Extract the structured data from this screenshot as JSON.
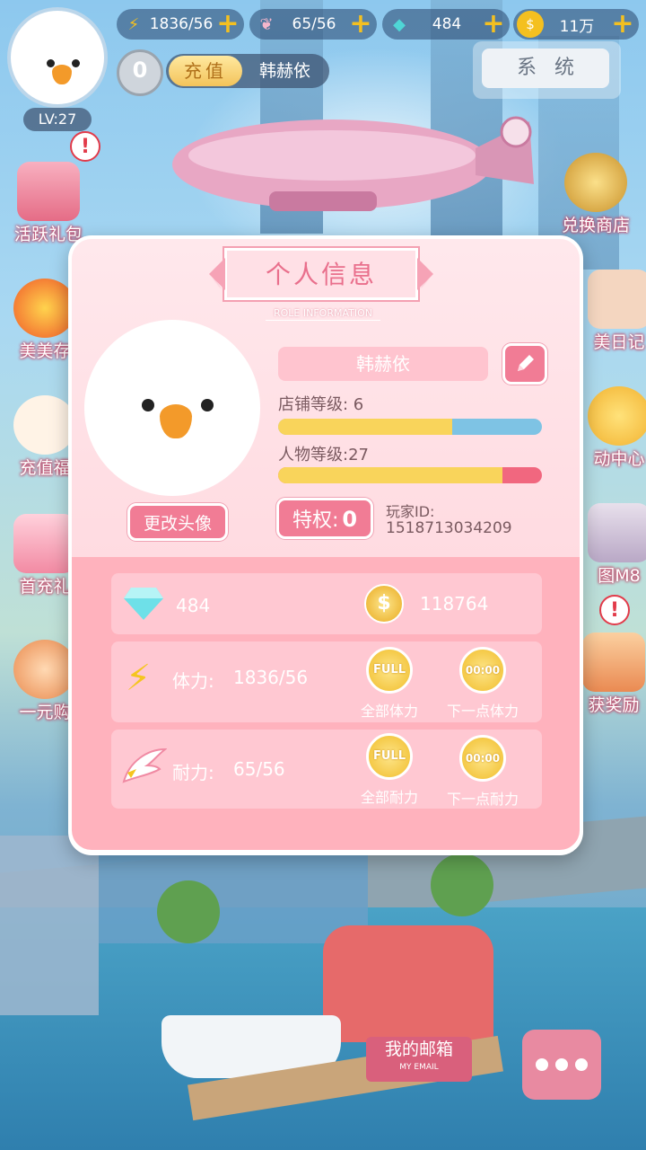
{
  "top_bar": {
    "energy": "1836/56",
    "stamina": "65/56",
    "diamonds": "484",
    "coins": "11万",
    "plus": "+"
  },
  "player": {
    "level": "LV:27",
    "vip_level": "0",
    "charge_label": "充值",
    "name": "韩赫依"
  },
  "system_button": "系统",
  "side_left": [
    {
      "label": "活跃礼包"
    },
    {
      "label": "美美存"
    },
    {
      "label": "充值福"
    },
    {
      "label": "首充礼"
    },
    {
      "label": "一元购"
    }
  ],
  "side_right": [
    {
      "label": "兑换商店"
    },
    {
      "label": "美日记"
    },
    {
      "label": "动中心"
    },
    {
      "label": "图M8"
    },
    {
      "label": "获奖励"
    }
  ],
  "alert_mark": "!",
  "mail": {
    "label": "我的邮箱",
    "sub": "MY EMAIL"
  },
  "dialog": {
    "title": "个人信息",
    "subtitle": "ROLE INFORMATION",
    "name": "韩赫依",
    "change_avatar": "更改头像",
    "shop_level_label": "店铺等级: 6",
    "shop_level_progress": 0.66,
    "char_level_label": "人物等级:27",
    "char_level_progress": 0.85,
    "privilege_label": "特权:",
    "privilege_value": "0",
    "player_id_label": "玩家ID:",
    "player_id": "1518713034209",
    "diamonds": "484",
    "coins": "118764",
    "energy_label": "体力:",
    "energy_value": "1836/56",
    "stamina_label": "耐力:",
    "stamina_value": "65/56",
    "full_badge": "FULL",
    "timer_badge": "00:00",
    "all_energy": "全部体力",
    "next_energy": "下一点体力",
    "all_stamina": "全部耐力",
    "next_stamina": "下一点耐力"
  },
  "colors": {
    "accent_pink": "#f17c95",
    "bar_yellow": "#f9d45b",
    "shop_bar_bg": "#7ec3e4",
    "char_bar_bg": "#f1677f"
  }
}
